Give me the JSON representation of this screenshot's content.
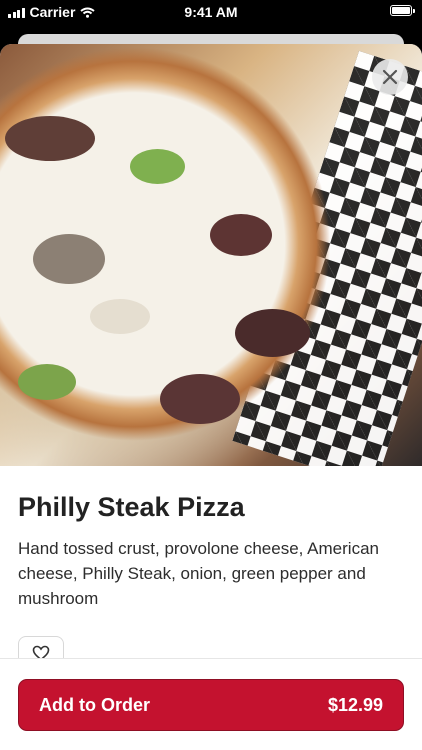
{
  "status_bar": {
    "carrier": "Carrier",
    "time": "9:41 AM"
  },
  "item": {
    "title": "Philly Steak Pizza",
    "description": "Hand tossed crust, provolone cheese, American cheese, Philly Steak, onion, green pepper and mushroom",
    "image": "pizza-photo"
  },
  "actions": {
    "add_to_order_label": "Add to Order",
    "price": "$12.99"
  },
  "icons": {
    "close": "close-icon",
    "favorite": "heart-icon",
    "wifi": "wifi-icon",
    "battery": "battery-icon",
    "signal": "signal-icon"
  },
  "colors": {
    "accent": "#c4122f"
  }
}
